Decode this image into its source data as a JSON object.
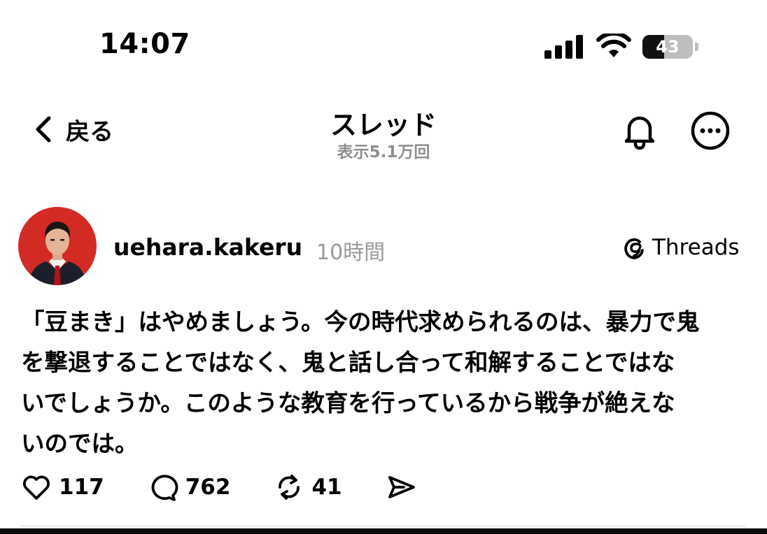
{
  "status_bar": {
    "time": "14:07",
    "battery_percent": "43",
    "battery_level": 0.43,
    "icons": [
      "signal-icon",
      "wifi-icon",
      "battery-icon"
    ]
  },
  "header": {
    "back_label": "戻る",
    "title": "スレッド",
    "subtitle": "表示5.1万回",
    "icons": [
      "chevron-left-icon",
      "bell-icon",
      "more-icon"
    ]
  },
  "post": {
    "username": "uehara.kakeru",
    "time": "10時間",
    "source_label": "Threads",
    "text": "「豆まき」はやめましょう。今の時代求められるのは、暴力で鬼\nを撃退することではなく、鬼と話し合って和解することではな\nいでしょうか。このような教育を行っているから戦争が絶えな\nいのでは。",
    "avatar_background": "#d42a24",
    "actions": {
      "likes": "117",
      "replies": "762",
      "reposts": "41"
    }
  },
  "colors": {
    "text": "#000000",
    "muted": "#8e8e8e",
    "divider": "#dcdcdc"
  }
}
